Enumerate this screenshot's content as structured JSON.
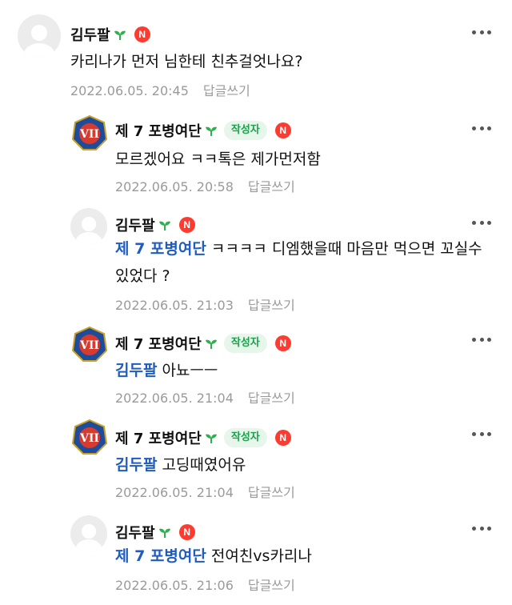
{
  "comments": [
    {
      "nickname": "김두팔",
      "is_author": false,
      "author_label": "",
      "new_badge": "N",
      "mention": "",
      "text": "카리나가 먼저 님한테 친추걸엇나요?",
      "date": "2022.06.05. 20:45",
      "reply_label": "답글쓰기",
      "avatar": "default-profile-icon"
    },
    {
      "nickname": "제 7 포병여단",
      "is_author": true,
      "author_label": "작성자",
      "new_badge": "N",
      "mention": "",
      "text": "모르겠어요 ㅋㅋ톡은 제가먼저함",
      "date": "2022.06.05. 20:58",
      "reply_label": "답글쓰기",
      "avatar": "vii-emblem-icon"
    },
    {
      "nickname": "김두팔",
      "is_author": false,
      "author_label": "",
      "new_badge": "N",
      "mention": "제 7 포병여단",
      "text": "ㅋㅋㅋㅋ 디엠했을때 마음만 먹으면 꼬실수 있었다 ?",
      "date": "2022.06.05. 21:03",
      "reply_label": "답글쓰기",
      "avatar": "default-profile-icon"
    },
    {
      "nickname": "제 7 포병여단",
      "is_author": true,
      "author_label": "작성자",
      "new_badge": "N",
      "mention": "김두팔",
      "text": "아뇨ㅡㅡ",
      "date": "2022.06.05. 21:04",
      "reply_label": "답글쓰기",
      "avatar": "vii-emblem-icon"
    },
    {
      "nickname": "제 7 포병여단",
      "is_author": true,
      "author_label": "작성자",
      "new_badge": "N",
      "mention": "김두팔",
      "text": "고딩때였어유",
      "date": "2022.06.05. 21:04",
      "reply_label": "답글쓰기",
      "avatar": "vii-emblem-icon"
    },
    {
      "nickname": "김두팔",
      "is_author": false,
      "author_label": "",
      "new_badge": "N",
      "mention": "제 7 포병여단",
      "text": "전여친vs카리나",
      "date": "2022.06.05. 21:06",
      "reply_label": "답글쓰기",
      "avatar": "default-profile-icon"
    }
  ],
  "colors": {
    "mention": "#1f5cbf",
    "author_tag_text": "#19a24a",
    "author_tag_bg": "#e6f6ea",
    "new_badge": "#ff3b30",
    "meta": "#9a9a9a"
  }
}
